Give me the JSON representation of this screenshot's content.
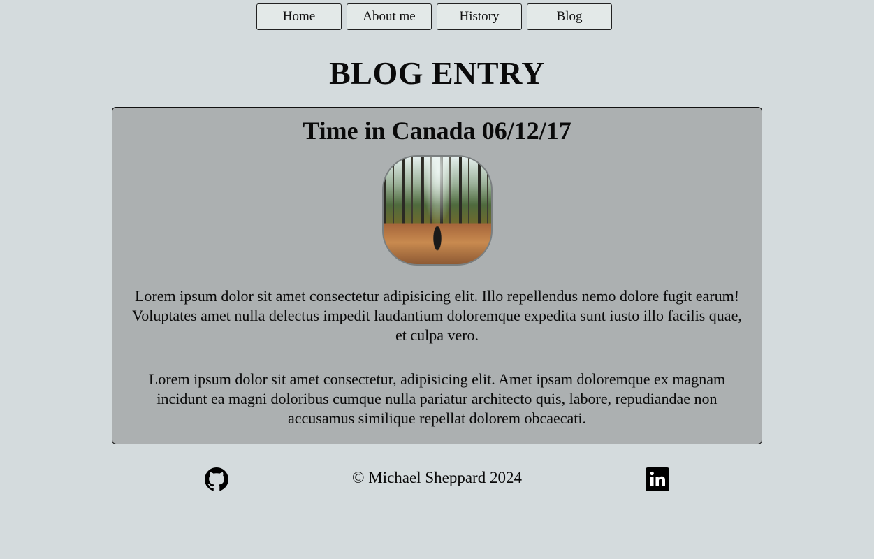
{
  "nav": {
    "items": [
      {
        "label": "Home"
      },
      {
        "label": "About me"
      },
      {
        "label": "History"
      },
      {
        "label": "Blog"
      }
    ]
  },
  "page_title": "BLOG ENTRY",
  "entry": {
    "title": "Time in Canada 06/12/17",
    "image_alt": "Person walking on a leaf-covered forest path",
    "paragraphs": [
      "Lorem ipsum dolor sit amet consectetur adipisicing elit. Illo repellendus nemo dolore fugit earum! Voluptates amet nulla delectus impedit laudantium doloremque expedita sunt iusto illo facilis quae, et culpa vero.",
      "Lorem ipsum dolor sit amet consectetur, adipisicing elit. Amet ipsam doloremque ex magnam incidunt ea magni doloribus cumque nulla pariatur architecto quis, labore, repudiandae non accusamus similique repellat dolorem obcaecati."
    ]
  },
  "footer": {
    "copyright": "© Michael Sheppard 2024",
    "icons": [
      "github-icon",
      "linkedin-icon"
    ]
  }
}
